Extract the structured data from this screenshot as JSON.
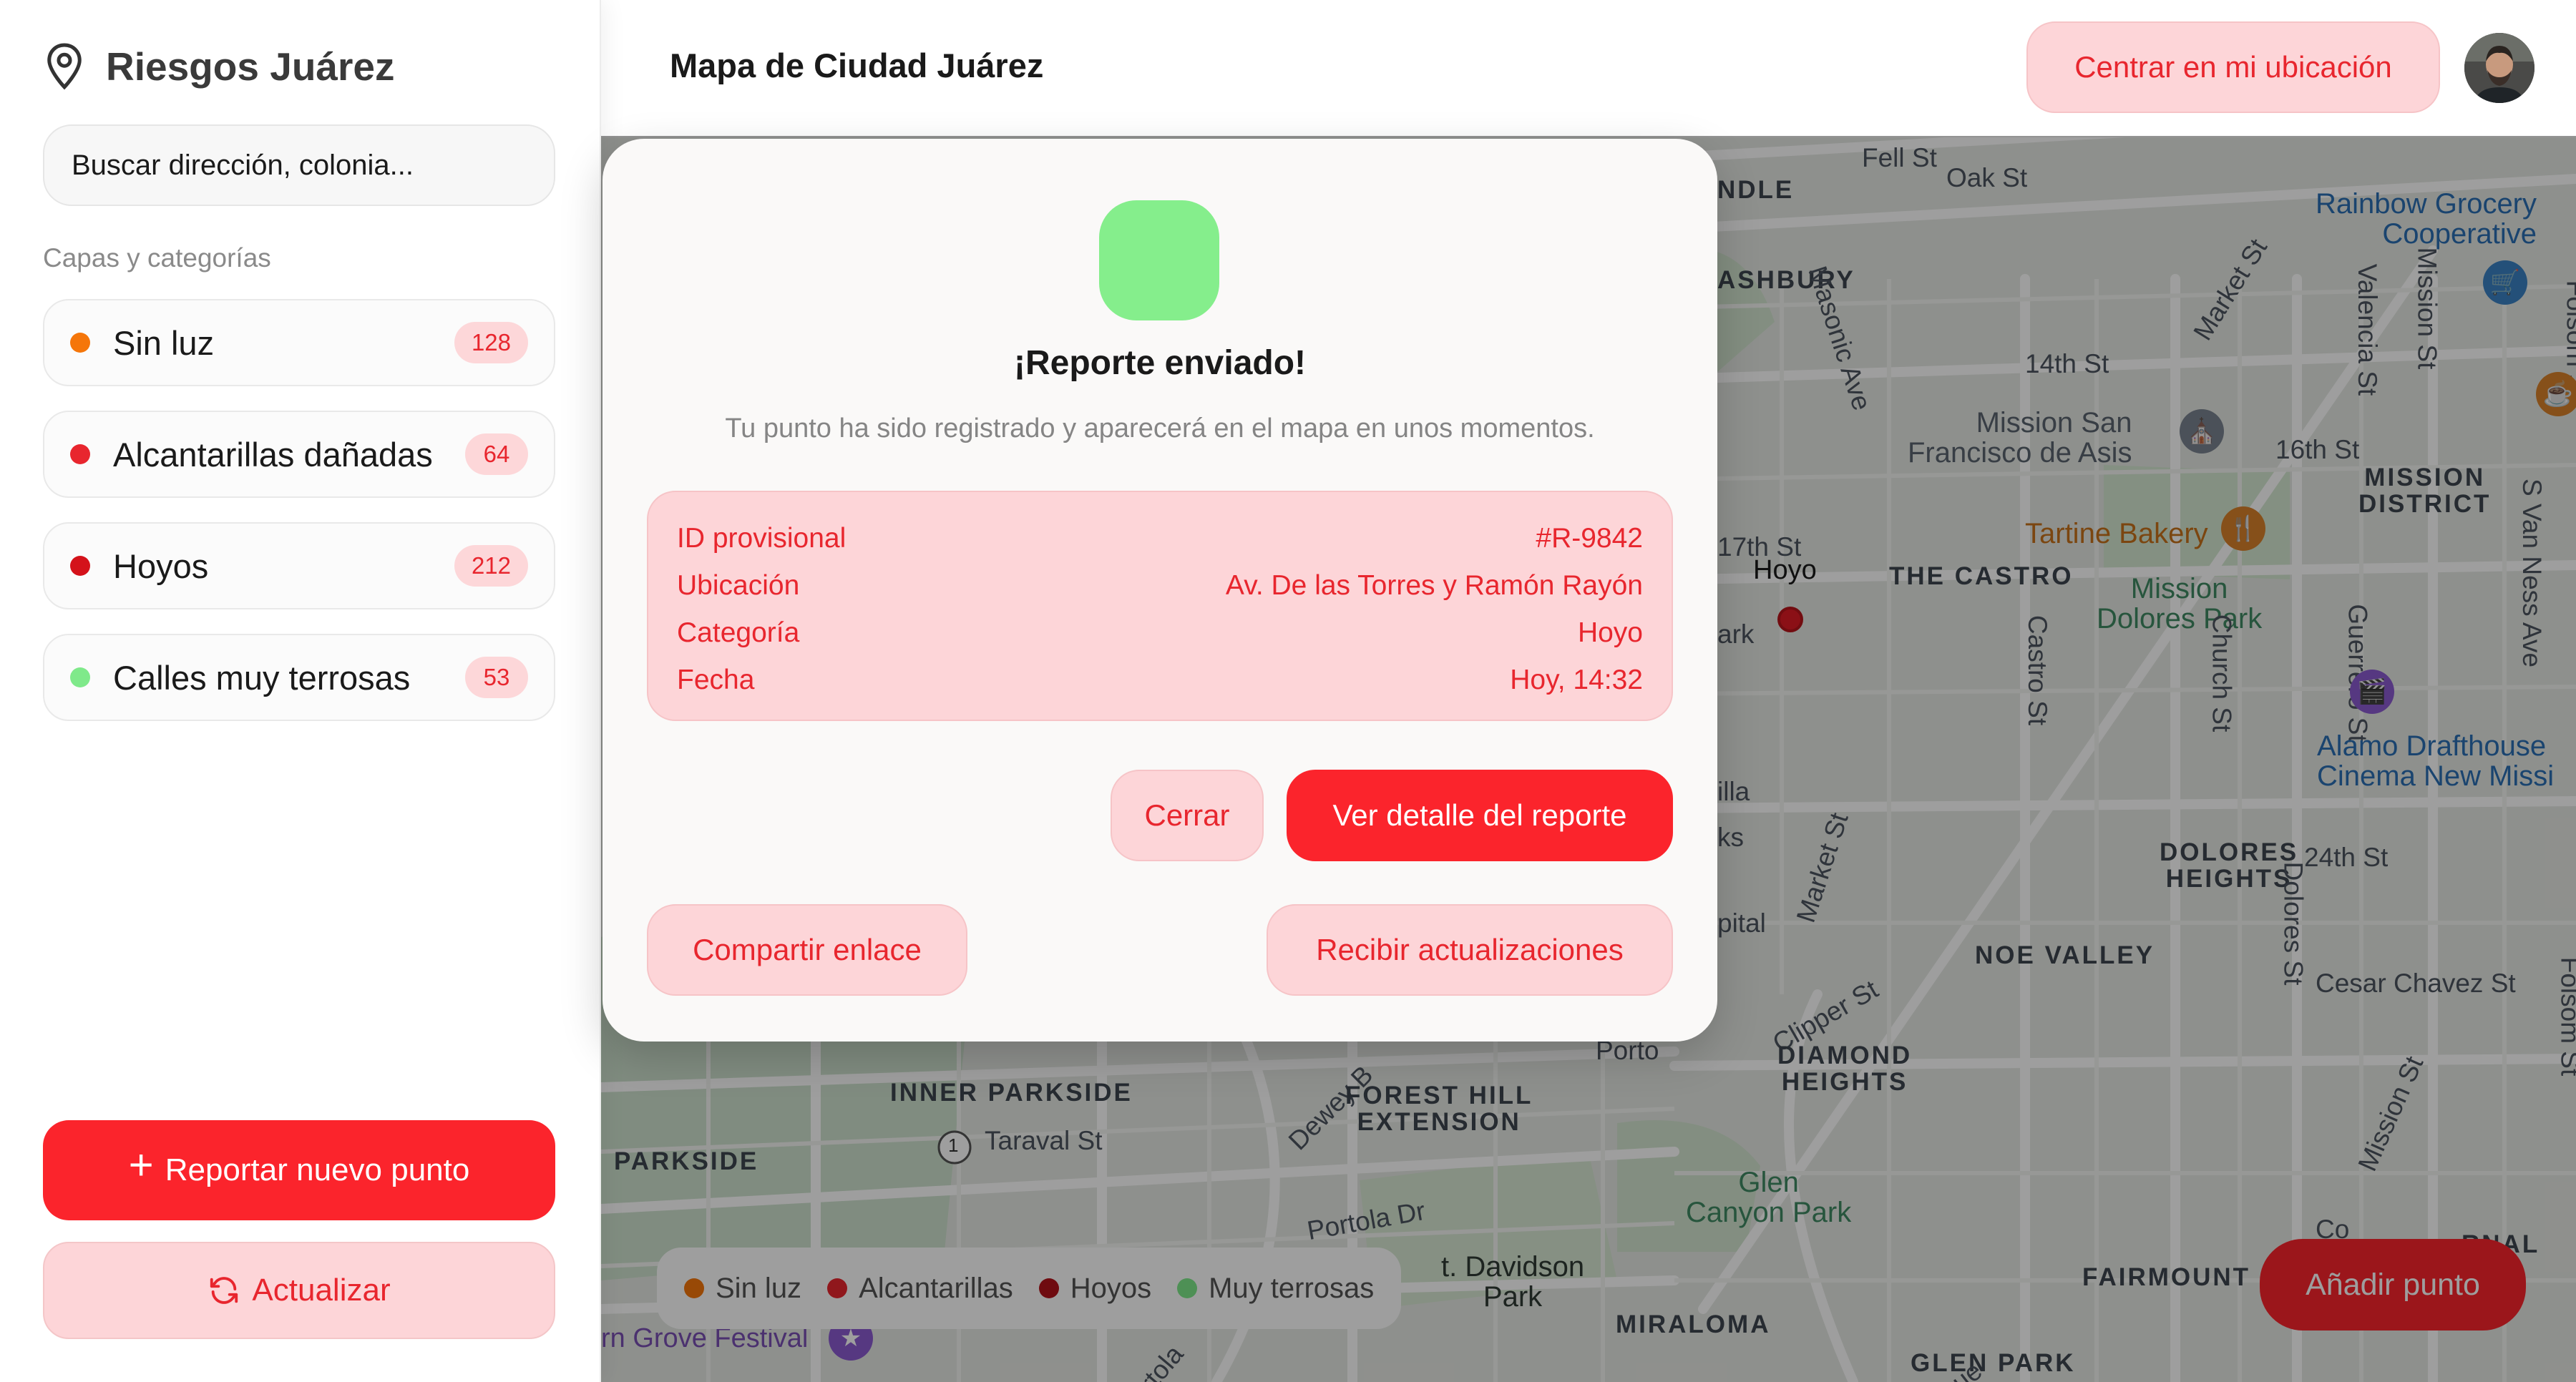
{
  "sidebar": {
    "app_title": "Riesgos Juárez",
    "search_placeholder": "Buscar dirección, colonia...",
    "section_label": "Capas y categorías",
    "layers": [
      {
        "label": "Sin luz",
        "count": "128",
        "color": "#f5760a"
      },
      {
        "label": "Alcantarillas dañadas",
        "count": "64",
        "color": "#e8262e"
      },
      {
        "label": "Hoyos",
        "count": "212",
        "color": "#d4121a"
      },
      {
        "label": "Calles muy terrosas",
        "count": "53",
        "color": "#7fe98a"
      }
    ],
    "report_button": "Reportar nuevo punto",
    "refresh_button": "Actualizar"
  },
  "header": {
    "title": "Mapa de Ciudad Juárez",
    "center_button": "Centrar en mi ubicación"
  },
  "map": {
    "labels": {
      "fell": "Fell St",
      "oak": "Oak St",
      "ndle": "NDLE",
      "ashbury": "ASHBURY",
      "masonic": "Masonic Ave",
      "market1": "Market St",
      "st14": "14th St",
      "valencia": "Valencia St",
      "mission_st": "Mission St",
      "folsom": "Folsom St",
      "rainbow": "Rainbow Grocery\nCooperative",
      "mission_san": "Mission San\nFrancisco de Asis",
      "st16": "16th St",
      "mission_district": "MISSION\nDISTRICT",
      "tartine": "Tartine Bakery",
      "st17": "17th St",
      "hoyo": "Hoyo",
      "castro": "THE CASTRO",
      "mission_dolores": "Mission\nDolores Park",
      "s_van_ness": "S Van Ness Ave",
      "ark": "ark",
      "castro_st": "Castro St",
      "church": "Church St",
      "guerrero": "Guerrero St",
      "alamo": "Alamo Drafthouse\nCinema New Missi",
      "illa": "illa",
      "ks": "ks",
      "market2": "Market St",
      "dolores_heights": "DOLORES\nHEIGHTS",
      "st24": "24th St",
      "pital": "pital",
      "dolores_st": "Dolores St",
      "noe": "NOE VALLEY",
      "clipper": "Clipper St",
      "cesar": "Cesar Chavez St",
      "mission_st2": "Mission St",
      "folsom2": "Folsom St",
      "portola": "Porto",
      "dewey": "Dewey B",
      "diamond": "DIAMOND\nHEIGHTS",
      "inner_parkside": "INNER PARKSIDE",
      "forest_hill": "FOREST HILL\nEXTENSION",
      "taraval": "Taraval St",
      "parkside": "PARKSIDE",
      "portola_dr": "Portola Dr",
      "glen_canyon": "Glen\nCanyon Park",
      "davidson": "t. Davidson\nPark",
      "fairmount": "FAIRMOUNT",
      "rnal": "RNAL",
      "co": "Co",
      "miraloma": "MIRALOMA",
      "glen_park": "GLEN PARK",
      "grove": "rn Grove Festival",
      "portola2": "Portola",
      "nue": "nue",
      "route": "1"
    },
    "legend": [
      {
        "label": "Sin luz",
        "color": "#f5760a"
      },
      {
        "label": "Alcantarillas",
        "color": "#e8262e"
      },
      {
        "label": "Hoyos",
        "color": "#b3121a"
      },
      {
        "label": "Muy terrosas",
        "color": "#7fe98a"
      }
    ],
    "add_button": "Añadir punto"
  },
  "modal": {
    "title": "¡Reporte enviado!",
    "subtitle": "Tu punto ha sido registrado y aparecerá en el mapa en unos momentos.",
    "details": [
      {
        "key": "ID provisional",
        "value": "#R-9842"
      },
      {
        "key": "Ubicación",
        "value": "Av. De las Torres y Ramón Rayón"
      },
      {
        "key": "Categoría",
        "value": "Hoyo"
      },
      {
        "key": "Fecha",
        "value": "Hoy, 14:32"
      }
    ],
    "close_button": "Cerrar",
    "view_button": "Ver detalle del reporte",
    "share_button": "Compartir enlace",
    "subscribe_button": "Recibir actualizaciones"
  },
  "colors": {
    "accent": "#fb242c",
    "accent_soft": "#fdd5d8",
    "success": "#85ee8c"
  }
}
